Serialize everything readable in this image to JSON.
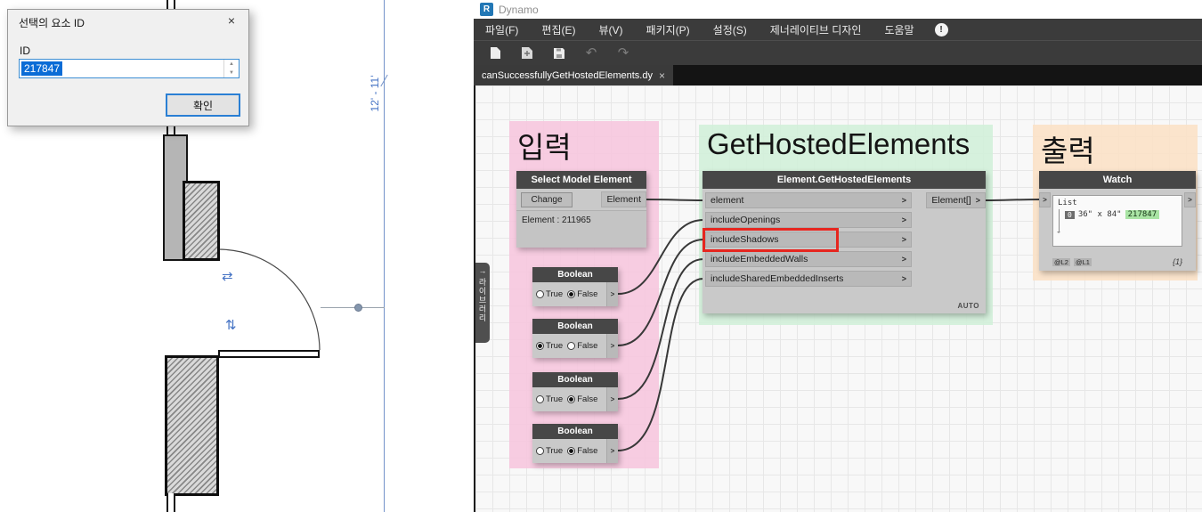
{
  "revit": {
    "dialog": {
      "title": "선택의 요소 ID",
      "close_icon": "×",
      "id_label": "ID",
      "id_value": "217847",
      "ok_label": "확인",
      "spin_up": "▲",
      "spin_down": "▼"
    },
    "dimension_label": "12' - 11'",
    "door_swing_icons": [
      "⇄",
      "⇅"
    ]
  },
  "dynamo": {
    "app_name": "Dynamo",
    "logo_letter": "R",
    "menu": [
      "파일(F)",
      "편집(E)",
      "뷰(V)",
      "패키지(P)",
      "설정(S)",
      "제너레이티브 디자인",
      "도움말"
    ],
    "notification_icon": "!",
    "toolbar": {
      "undo_glyph": "↶",
      "redo_glyph": "↷"
    },
    "tab_label": "canSuccessfullyGetHostedElements.dy",
    "tab_close": "×",
    "library_label": "라이브러리",
    "library_arrow": "→",
    "chevron": ">",
    "groups": [
      {
        "title": "입력",
        "color": "rgba(247,196,221,0.85)"
      },
      {
        "title": "GetHostedElements",
        "color": "rgba(208,240,216,0.85)"
      },
      {
        "title": "출력",
        "color": "rgba(252,224,196,0.85)"
      }
    ],
    "select_node": {
      "title": "Select Model Element",
      "button": "Change",
      "output": "Element",
      "value": "Element : 211965"
    },
    "booleans": [
      {
        "title": "Boolean",
        "options": [
          "True",
          "False"
        ],
        "value": "False"
      },
      {
        "title": "Boolean",
        "options": [
          "True",
          "False"
        ],
        "value": "True"
      },
      {
        "title": "Boolean",
        "options": [
          "True",
          "False"
        ],
        "value": "False"
      },
      {
        "title": "Boolean",
        "options": [
          "True",
          "False"
        ],
        "value": "False"
      }
    ],
    "get_hosted_node": {
      "title": "Element.GetHostedElements",
      "inputs": [
        "element",
        "includeOpenings",
        "includeShadows",
        "includeEmbeddedWalls",
        "includeSharedEmbeddedInserts"
      ],
      "highlighted_input": "includeShadows",
      "output": "Element[]",
      "auto_label": "AUTO"
    },
    "watch_node": {
      "title": "Watch",
      "list_label": "List",
      "row_index": "0",
      "row_text": "36\" x 84\"",
      "row_value": "217847",
      "level_tags": [
        "@L2",
        "@L1"
      ],
      "count": "{1}"
    }
  }
}
